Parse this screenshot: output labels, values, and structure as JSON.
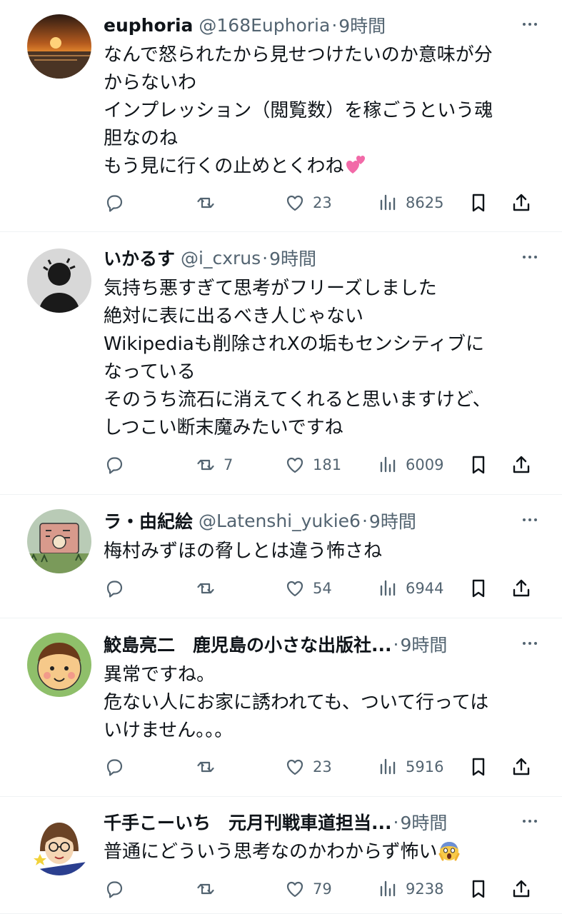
{
  "replies": [
    {
      "name": "euphoria",
      "handle": "@168Euphoria",
      "separator": "·",
      "time": "9時間",
      "lines": [
        "なんで怒られたから見せつけたいのか意味が分",
        "からないわ",
        "インプレッション（閲覧数）を稼ごうという魂",
        "胆なのね",
        "もう見に行くの止めとくわね"
      ],
      "emoji": "two-hearts-emoji",
      "stats": {
        "replies": "",
        "reposts": "",
        "likes": "23",
        "views": "8625"
      }
    },
    {
      "name": "いかるす",
      "handle": "@i_cxrus",
      "separator": "·",
      "time": "9時間",
      "lines": [
        "気持ち悪すぎて思考がフリーズしました",
        "絶対に表に出るべき人じゃない",
        "Wikipediaも削除されXの垢もセンシティブに",
        "なっている",
        "そのうち流石に消えてくれると思いますけど、",
        "しつこい断末魔みたいですね"
      ],
      "stats": {
        "replies": "",
        "reposts": "7",
        "likes": "181",
        "views": "6009"
      }
    },
    {
      "name": "ラ・由紀絵",
      "handle": "@Latenshi_yukie6",
      "separator": "·",
      "time": "9時間",
      "lines": [
        "梅村みずほの脅しとは違う怖さね"
      ],
      "stats": {
        "replies": "",
        "reposts": "",
        "likes": "54",
        "views": "6944"
      }
    },
    {
      "name": "鮫島亮二　鹿児島の小さな出版社...",
      "handle": "",
      "separator": "·",
      "time": "9時間",
      "lines": [
        "異常ですね。",
        "危ない人にお家に誘われても、ついて行っては",
        "いけません。。。"
      ],
      "stats": {
        "replies": "",
        "reposts": "",
        "likes": "23",
        "views": "5916"
      }
    },
    {
      "name": "千手こーいち　元月刊戦車道担当...",
      "handle": "",
      "separator": "·",
      "time": "9時間",
      "lines": [
        "普通にどういう思考なのかわからず怖い"
      ],
      "emoji": "screaming-face-emoji",
      "stats": {
        "replies": "",
        "reposts": "",
        "likes": "79",
        "views": "9238"
      }
    }
  ],
  "icons": {
    "reply": "reply-icon",
    "repost": "repost-icon",
    "like": "heart-icon",
    "views": "views-icon",
    "bookmark": "bookmark-icon",
    "share": "share-icon",
    "more": "more-icon"
  },
  "colors": {
    "text": "#0f1419",
    "secondary": "#536471",
    "divider": "#eff3f4"
  }
}
